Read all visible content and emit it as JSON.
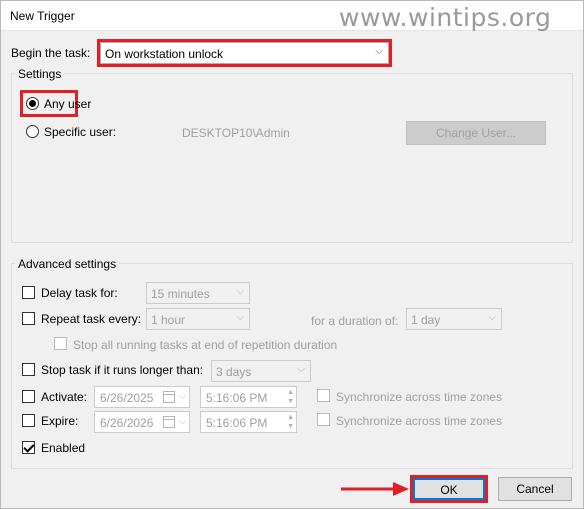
{
  "window": {
    "title": "New Trigger",
    "watermark": "www.wintips.org"
  },
  "begin": {
    "label": "Begin the task:",
    "value": "On workstation unlock"
  },
  "settings": {
    "title": "Settings",
    "any_user": "Any user",
    "specific_user": "Specific user:",
    "user_value": "DESKTOP10\\Admin",
    "change_user": "Change User..."
  },
  "advanced": {
    "title": "Advanced settings",
    "delay_label": "Delay task for:",
    "delay_value": "15 minutes",
    "repeat_label": "Repeat task every:",
    "repeat_value": "1 hour",
    "duration_label": "for a duration of:",
    "duration_value": "1 day",
    "stop_running_label": "Stop all running tasks at end of repetition duration",
    "stop_longer_label": "Stop task if it runs longer than:",
    "stop_longer_value": "3 days",
    "activate_label": "Activate:",
    "activate_date": "6/26/2025",
    "activate_time": "5:16:06 PM",
    "expire_label": "Expire:",
    "expire_date": "6/26/2026",
    "expire_time": "5:16:06 PM",
    "sync_label": "Synchronize across time zones",
    "enabled_label": "Enabled",
    "enabled_checked": true
  },
  "buttons": {
    "ok": "OK",
    "cancel": "Cancel"
  },
  "colors": {
    "highlight": "#e01f26",
    "primary_border": "#0078d7"
  }
}
